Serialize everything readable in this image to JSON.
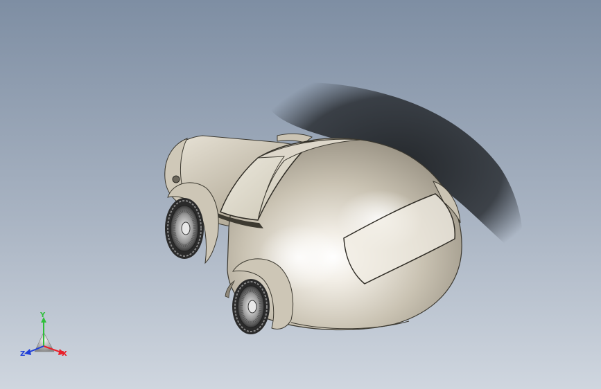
{
  "viewport": {
    "background_top": "#7f8fa4",
    "background_bottom": "#ced6e0",
    "model_body_color": "#d8d2c4",
    "model_shadow_color": "#222528"
  },
  "triad": {
    "x_label": "X",
    "y_label": "Y",
    "z_label": "Z",
    "x_color": "#e8202a",
    "y_color": "#2fbf3a",
    "z_color": "#1f3fd8"
  }
}
